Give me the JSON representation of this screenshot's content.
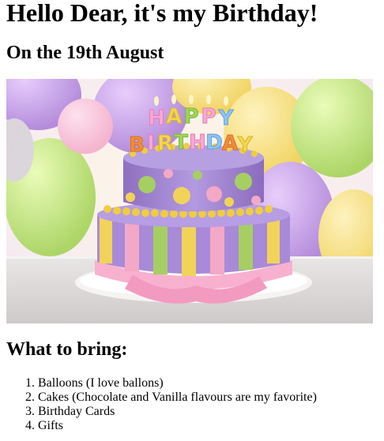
{
  "page": {
    "title": "Hello Dear, it's my Birthday!",
    "date_line": "On the 19th August"
  },
  "image": {
    "icon": "birthday-cake-photo",
    "candle_letters": [
      "H",
      "A",
      "P",
      "P",
      "Y",
      "B",
      "I",
      "R",
      "T",
      "H",
      "D",
      "A",
      "Y"
    ]
  },
  "bring": {
    "heading": "What to bring:",
    "items": [
      "Balloons (I love ballons)",
      "Cakes (Chocolate and Vanilla flavours are my favorite)",
      "Birthday Cards",
      "Gifts"
    ]
  },
  "colors": {
    "cake_purple": "#9b7fc9",
    "cake_yellow": "#f1d35a",
    "cake_green": "#a6cf63",
    "cake_pink": "#f3a8c6",
    "balloon_purple": "#b98be0",
    "balloon_green": "#b9e070",
    "balloon_yellow": "#f6dc6a"
  }
}
